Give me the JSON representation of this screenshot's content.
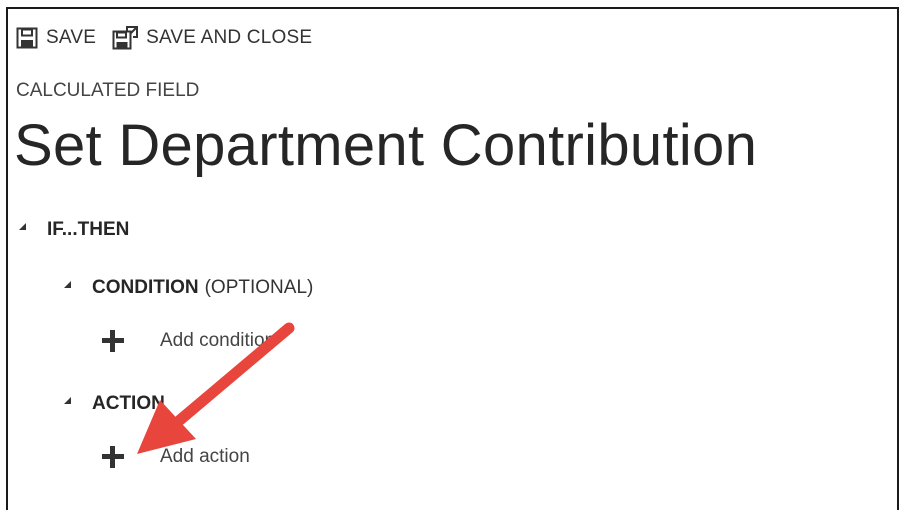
{
  "toolbar": {
    "save_label": "SAVE",
    "save_close_label": "SAVE AND CLOSE"
  },
  "header": {
    "entity_label": "CALCULATED FIELD",
    "title": "Set Department Contribution"
  },
  "rule": {
    "if_then_label": "IF...THEN",
    "condition_label": "CONDITION",
    "condition_optional": "(OPTIONAL)",
    "add_condition_label": "Add condition",
    "action_label": "ACTION",
    "add_action_label": "Add action"
  },
  "annotation": {
    "arrow_color": "#e8453c"
  }
}
